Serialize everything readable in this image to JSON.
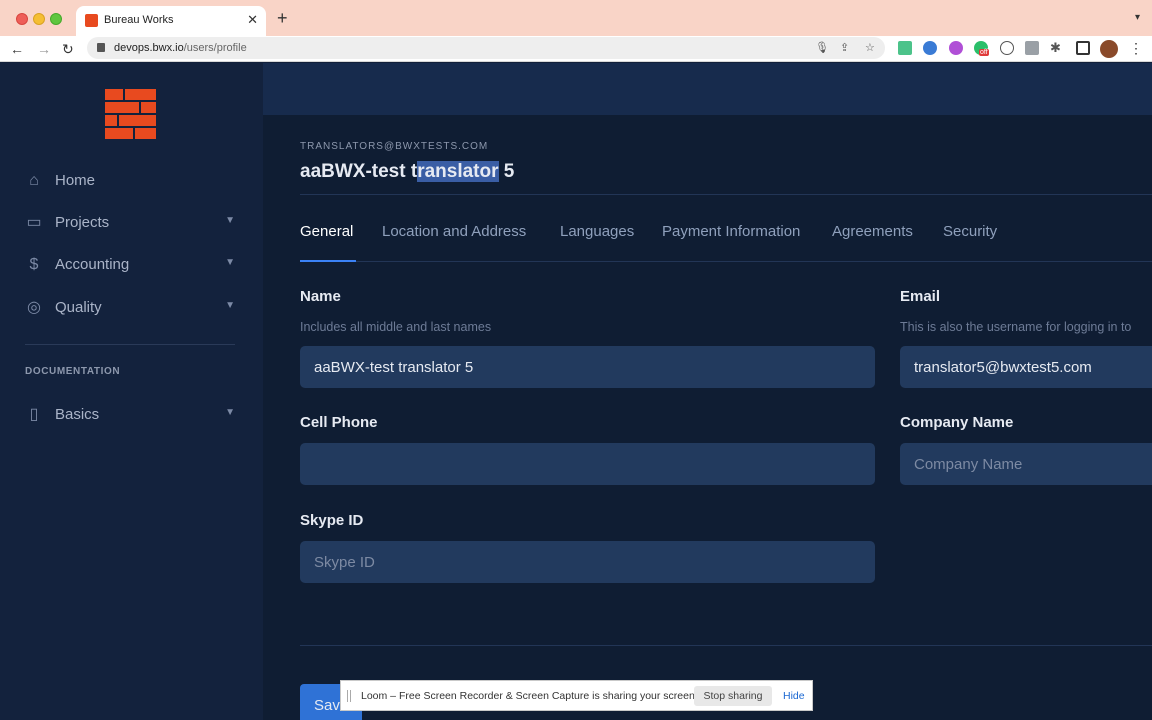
{
  "browser": {
    "tab_title": "Bureau Works",
    "url_host": "devops.bwx.io",
    "url_path": "/users/profile",
    "icons": [
      "back-icon",
      "forward-icon",
      "reload-icon",
      "lock-icon",
      "mic-icon",
      "share-icon",
      "star-icon",
      "extensions-icon",
      "sidebar-icon",
      "avatar",
      "menu-icon"
    ],
    "ext_badge": "off"
  },
  "sidebar": {
    "items": [
      {
        "label": "Home",
        "icon": "home-icon"
      },
      {
        "label": "Projects",
        "icon": "folder-icon"
      },
      {
        "label": "Accounting",
        "icon": "dollar-icon"
      },
      {
        "label": "Quality",
        "icon": "compass-icon"
      }
    ],
    "section_label": "DOCUMENTATION",
    "doc_items": [
      {
        "label": "Basics",
        "icon": "clipboard-icon"
      }
    ]
  },
  "profile": {
    "email_caption": "TRANSLATORS@BWXTESTS.COM",
    "name_prefix": "aaBWX-test t",
    "name_selected": "ranslator",
    "name_suffix": " 5"
  },
  "tabs": [
    "General",
    "Location and Address",
    "Languages",
    "Payment Information",
    "Agreements",
    "Security"
  ],
  "form": {
    "name_label": "Name",
    "name_help": "Includes all middle and last names",
    "name_value": "aaBWX-test translator 5",
    "email_label": "Email",
    "email_help": "This is also the username for logging in to",
    "email_value": "translator5@bwxtest5.com",
    "cell_label": "Cell Phone",
    "cell_value": "",
    "company_label": "Company Name",
    "company_placeholder": "Company Name",
    "skype_label": "Skype ID",
    "skype_placeholder": "Skype ID",
    "save_label": "Save"
  },
  "loom": {
    "message": "Loom – Free Screen Recorder & Screen Capture is sharing your screen.",
    "stop_label": "Stop sharing",
    "hide_label": "Hide"
  },
  "colors": {
    "brand": "#e84a1f",
    "sidebar_bg": "#13223d",
    "main_bg": "#0f1d33",
    "input_bg": "#223a5e",
    "accent": "#3b82f6",
    "selection": "#3a5ea5"
  }
}
